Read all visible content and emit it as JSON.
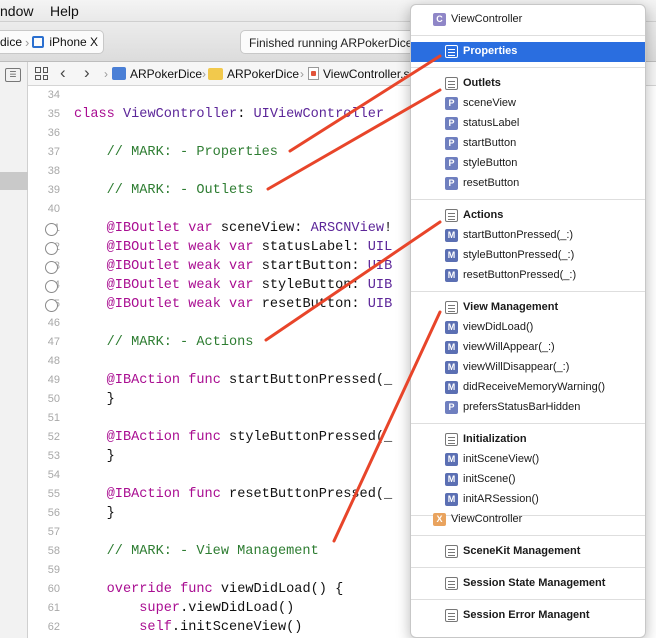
{
  "menubar": {
    "items": [
      "ndow",
      "Help"
    ]
  },
  "toolbar": {
    "scheme_left": "dice",
    "device": "iPhone X",
    "status": "Finished running ARPokerDice"
  },
  "jumpbar": {
    "crumbs": [
      "ARPokerDice",
      "ARPokerDice",
      "ViewController.s"
    ]
  },
  "editor": {
    "lines": [
      {
        "n": "34",
        "code": ""
      },
      {
        "n": "35",
        "code": "class ViewController: UIViewController"
      },
      {
        "n": "36",
        "code": ""
      },
      {
        "n": "37",
        "code": "    // MARK: - Properties"
      },
      {
        "n": "38",
        "code": ""
      },
      {
        "n": "39",
        "code": "    // MARK: - Outlets"
      },
      {
        "n": "40",
        "code": ""
      },
      {
        "n": "41",
        "code": "    @IBOutlet var sceneView: ARSCNView!"
      },
      {
        "n": "42",
        "code": "    @IBOutlet weak var statusLabel: UIL"
      },
      {
        "n": "43",
        "code": "    @IBOutlet weak var startButton: UIB"
      },
      {
        "n": "44",
        "code": "    @IBOutlet weak var styleButton: UIB"
      },
      {
        "n": "45",
        "code": "    @IBOutlet weak var resetButton: UIB"
      },
      {
        "n": "46",
        "code": ""
      },
      {
        "n": "47",
        "code": "    // MARK: - Actions"
      },
      {
        "n": "48",
        "code": ""
      },
      {
        "n": "49",
        "code": "    @IBAction func startButtonPressed(_"
      },
      {
        "n": "50",
        "code": "    }"
      },
      {
        "n": "51",
        "code": ""
      },
      {
        "n": "52",
        "code": "    @IBAction func styleButtonPressed(_"
      },
      {
        "n": "53",
        "code": "    }"
      },
      {
        "n": "54",
        "code": ""
      },
      {
        "n": "55",
        "code": "    @IBAction func resetButtonPressed(_"
      },
      {
        "n": "56",
        "code": "    }"
      },
      {
        "n": "57",
        "code": ""
      },
      {
        "n": "58",
        "code": "    // MARK: - View Management"
      },
      {
        "n": "59",
        "code": ""
      },
      {
        "n": "60",
        "code": "    override func viewDidLoad() {"
      },
      {
        "n": "61",
        "code": "        super.viewDidLoad()"
      },
      {
        "n": "62",
        "code": "        self.initSceneView()"
      }
    ]
  },
  "popup": {
    "items": [
      {
        "kind": "class",
        "badge": "C",
        "label": "ViewController"
      },
      {
        "kind": "mark",
        "label": "Properties",
        "selected": true
      },
      {
        "kind": "mark",
        "label": "Outlets"
      },
      {
        "kind": "prop",
        "badge": "P",
        "label": "sceneView"
      },
      {
        "kind": "prop",
        "badge": "P",
        "label": "statusLabel"
      },
      {
        "kind": "prop",
        "badge": "P",
        "label": "startButton"
      },
      {
        "kind": "prop",
        "badge": "P",
        "label": "styleButton"
      },
      {
        "kind": "prop",
        "badge": "P",
        "label": "resetButton"
      },
      {
        "kind": "mark",
        "label": "Actions"
      },
      {
        "kind": "method",
        "badge": "M",
        "label": "startButtonPressed(_:)"
      },
      {
        "kind": "method",
        "badge": "M",
        "label": "styleButtonPressed(_:)"
      },
      {
        "kind": "method",
        "badge": "M",
        "label": "resetButtonPressed(_:)"
      },
      {
        "kind": "mark",
        "label": "View Management"
      },
      {
        "kind": "method",
        "badge": "M",
        "label": "viewDidLoad()"
      },
      {
        "kind": "method",
        "badge": "M",
        "label": "viewWillAppear(_:)"
      },
      {
        "kind": "method",
        "badge": "M",
        "label": "viewWillDisappear(_:)"
      },
      {
        "kind": "method",
        "badge": "M",
        "label": "didReceiveMemoryWarning()"
      },
      {
        "kind": "prop",
        "badge": "P",
        "label": "prefersStatusBarHidden"
      },
      {
        "kind": "mark",
        "label": "Initialization"
      },
      {
        "kind": "method",
        "badge": "M",
        "label": "initSceneView()"
      },
      {
        "kind": "method",
        "badge": "M",
        "label": "initScene()"
      },
      {
        "kind": "method",
        "badge": "M",
        "label": "initARSession()"
      },
      {
        "kind": "extension",
        "badge": "X",
        "label": "ViewController"
      },
      {
        "kind": "mark",
        "label": "SceneKit Management"
      },
      {
        "kind": "mark",
        "label": "Session State Management"
      },
      {
        "kind": "mark",
        "label": "Session Error Managent"
      }
    ]
  },
  "colors": {
    "keyword": "#a90d91",
    "type": "#5c2699",
    "comment": "#2e7d32",
    "selection": "#2a6ee0",
    "annotation_arrow": "#e8452a"
  }
}
